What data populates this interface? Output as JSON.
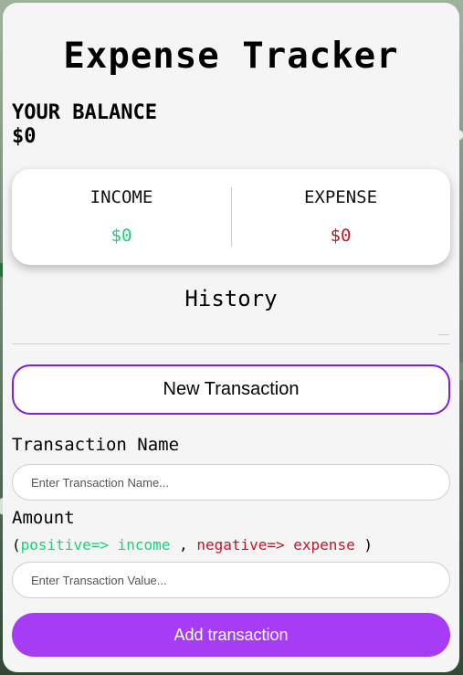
{
  "app": {
    "title": "Expense Tracker"
  },
  "balance": {
    "label": "YOUR BALANCE",
    "value": "$0"
  },
  "summary": {
    "income_label": "INCOME",
    "income_value": "$0",
    "expense_label": "EXPENSE",
    "expense_value": "$0"
  },
  "history": {
    "heading": "History"
  },
  "new_transaction": {
    "label": "New Transaction"
  },
  "form": {
    "name_label": "Transaction Name",
    "name_placeholder": "Enter Transaction Name...",
    "amount_label": "Amount",
    "hint_open": "(",
    "hint_positive": "positive=> income",
    "hint_sep": " , ",
    "hint_negative": "negative=> expense",
    "hint_close": " )",
    "amount_placeholder": "Enter Transaction Value...",
    "submit_label": "Add transaction"
  },
  "colors": {
    "income": "#19d37a",
    "expense": "#c0182a",
    "accent": "#a63cf6",
    "new_tx_border": "#7b1fe0"
  }
}
